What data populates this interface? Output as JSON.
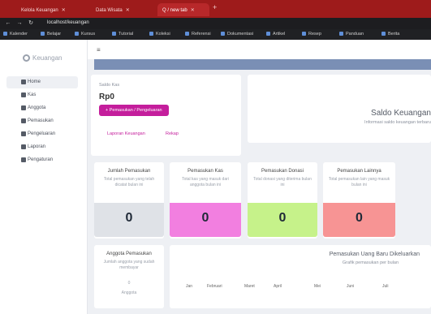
{
  "browser": {
    "tabs": [
      "Kelola Keuangan",
      "Data Wisata",
      "Q / new tab"
    ],
    "url": "localhost/keuangan",
    "bookmarks": [
      "Kalender",
      "Belajar",
      "Kursus",
      "Tutorial",
      "Koleksi",
      "Referensi",
      "Dokumentasi",
      "Artikel",
      "Resep",
      "Panduan",
      "Berita"
    ]
  },
  "sidebar": {
    "logo": "Keuangan",
    "items": [
      {
        "label": "Home"
      },
      {
        "label": "Kas"
      },
      {
        "label": "Anggota"
      },
      {
        "label": "Pemasukan"
      },
      {
        "label": "Pengeluaran"
      },
      {
        "label": "Laporan"
      },
      {
        "label": "Pengaturan"
      }
    ]
  },
  "saldo_card": {
    "title": "Saldo Kas",
    "value": "Rp0",
    "button": "+ Pemasukan / Pengeluaran",
    "links": [
      "Laporan Keuangan",
      "Rekap"
    ]
  },
  "hero": {
    "title": "Saldo Keuangan",
    "subtitle": "Informasi saldo keuangan terbaru"
  },
  "stats": [
    {
      "title": "Jumlah Pemasukan",
      "desc": "Total pemasukan yang telah dicatat bulan ini",
      "value": "0",
      "color": "#dfe2e7"
    },
    {
      "title": "Pemasukan Kas",
      "desc": "Total kas yang masuk dari anggota bulan ini",
      "value": "0",
      "color": "#f27fe0"
    },
    {
      "title": "Pemasukan Donasi",
      "desc": "Total donasi yang diterima bulan ini",
      "value": "0",
      "color": "#c6f28a"
    },
    {
      "title": "Pemasukan Lainnya",
      "desc": "Total pemasukan lain yang masuk bulan ini",
      "value": "0",
      "color": "#f79494"
    }
  ],
  "members": {
    "title": "Anggota Pemasukan",
    "desc": "Jumlah anggota yang sudah membayar",
    "value": "0",
    "footer": "Anggota"
  },
  "trend": {
    "title": "Pemasukan Uang Baru Dikeluarkan",
    "subtitle": "Grafik pemasukan per bulan",
    "months": [
      "Jan",
      "Februari",
      "Maret",
      "April",
      "Mei",
      "Juni",
      "Juli"
    ]
  }
}
